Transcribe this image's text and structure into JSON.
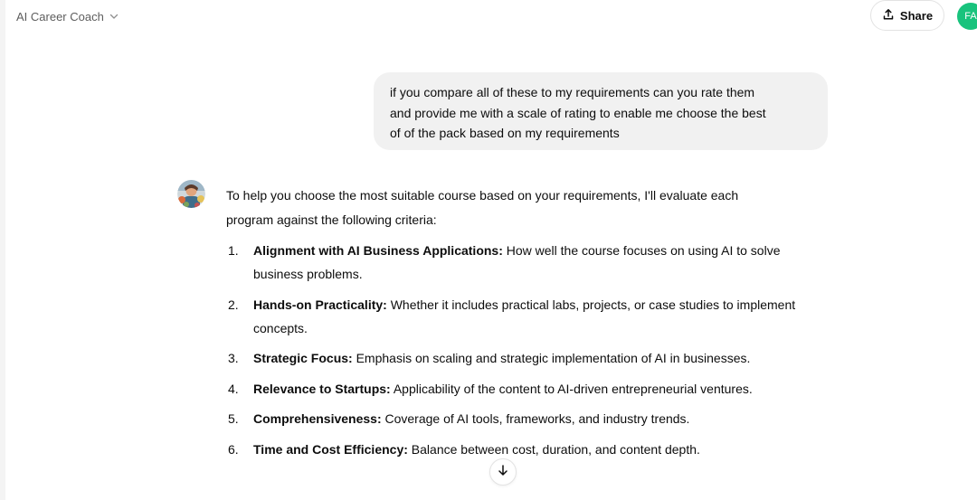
{
  "header": {
    "model_name": "AI Career Coach",
    "share_label": "Share",
    "avatar_initials": "FA"
  },
  "colors": {
    "avatar_bg": "#19c37d",
    "user_bubble_bg": "#f1f1f1"
  },
  "conversation": {
    "user_message": {
      "lines": [
        "if you compare all of these to my requirements can you rate them",
        "and provide me with a scale of rating to enable me choose the best",
        "of of the pack based on my requirements"
      ]
    },
    "assistant_message": {
      "intro_lines": [
        "To help you choose the most suitable course based on your requirements, I'll evaluate each",
        "program against the following criteria:"
      ],
      "criteria": [
        {
          "number": "1.",
          "title": "Alignment with AI Business Applications:",
          "text": "How well the course focuses on using AI to solve business problems."
        },
        {
          "number": "2.",
          "title": "Hands-on Practicality:",
          "text": "Whether it includes practical labs, projects, or case studies to implement concepts."
        },
        {
          "number": "3.",
          "title": "Strategic Focus:",
          "text": "Emphasis on scaling and strategic implementation of AI in businesses."
        },
        {
          "number": "4.",
          "title": "Relevance to Startups:",
          "text": "Applicability of the content to AI-driven entrepreneurial ventures."
        },
        {
          "number": "5.",
          "title": "Comprehensiveness:",
          "text": "Coverage of AI tools, frameworks, and industry trends."
        },
        {
          "number": "6.",
          "title": "Time and Cost Efficiency:",
          "text": "Balance between cost, duration, and content depth."
        }
      ]
    }
  },
  "icons": {
    "model_dropdown": "chevron-down-icon",
    "share": "share-icon",
    "scroll": "arrow-down-icon",
    "assistant": "assistant-avatar-image"
  }
}
